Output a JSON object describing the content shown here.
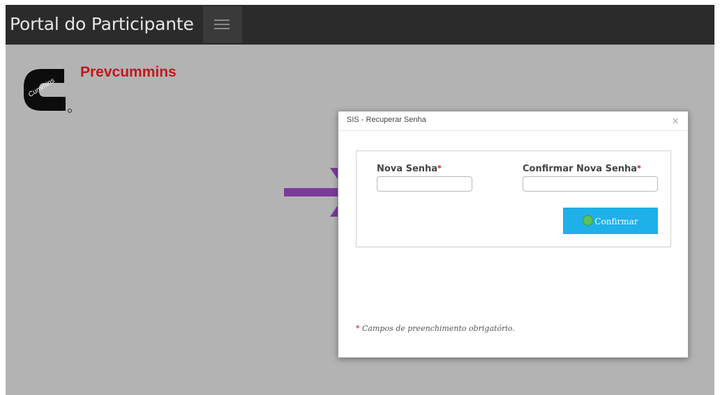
{
  "header": {
    "title": "Portal do Participante",
    "menu_icon": "hamburger-menu-icon"
  },
  "brand": {
    "logo_text": "Cummins",
    "name": "Prevcummins",
    "color": "#c0181b"
  },
  "modal": {
    "title": "SIS - Recuperar Senha",
    "close": "×",
    "fields": [
      {
        "label": "Nova Senha",
        "value": "",
        "required": true
      },
      {
        "label": "Confirmar Nova Senha",
        "value": "",
        "required": true
      }
    ],
    "required_mark": "*",
    "confirm_label": "Confirmar",
    "confirm_color": "#1eb0e8",
    "note": "Campos de preenchimento obrigatório."
  },
  "annotation": {
    "arrow_color": "#7b3a9a",
    "arrow_icon": "right-arrow-icon"
  },
  "colors": {
    "topbar": "#2b2b2b",
    "background": "#b3b3b3"
  }
}
